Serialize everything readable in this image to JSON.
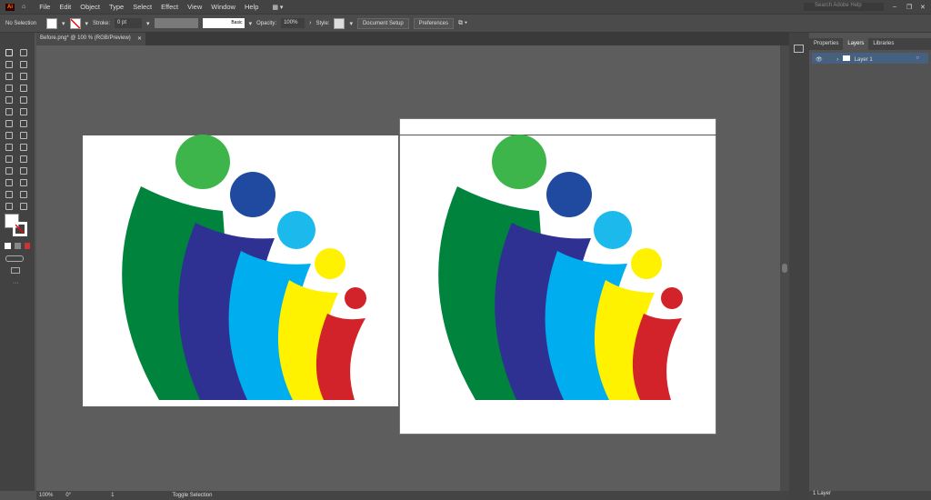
{
  "app": {
    "logo": "Ai",
    "menus": [
      "File",
      "Edit",
      "Object",
      "Type",
      "Select",
      "Effect",
      "View",
      "Window",
      "Help"
    ],
    "search_placeholder": "Search Adobe Help"
  },
  "control": {
    "selection": "No Selection",
    "stroke_label": "Stroke:",
    "stroke_value": "0 pt",
    "brush": "Basic",
    "opacity_label": "Opacity:",
    "opacity_value": "100%",
    "style_label": "Style:",
    "document_setup": "Document Setup",
    "preferences": "Preferences"
  },
  "document": {
    "tab_title": "Before.png* @ 100 % (RGB/Preview)"
  },
  "panel": {
    "tabs": [
      "Properties",
      "Layers",
      "Libraries"
    ],
    "layers": [
      {
        "name": "Layer 1"
      }
    ],
    "layer_count": "1 Layer"
  },
  "status": {
    "zoom": "100%",
    "rotation": "0°",
    "artboard": "1",
    "tool": "Toggle Selection"
  },
  "colors": {
    "green": "#3db54a",
    "darkblue": "#1f4aa0",
    "lightblue": "#1cb9ec",
    "yellow": "#fff200",
    "red": "#d2232a",
    "band_green": "#00843d",
    "band_blue": "#2e3192",
    "band_cyan": "#00aeef"
  }
}
